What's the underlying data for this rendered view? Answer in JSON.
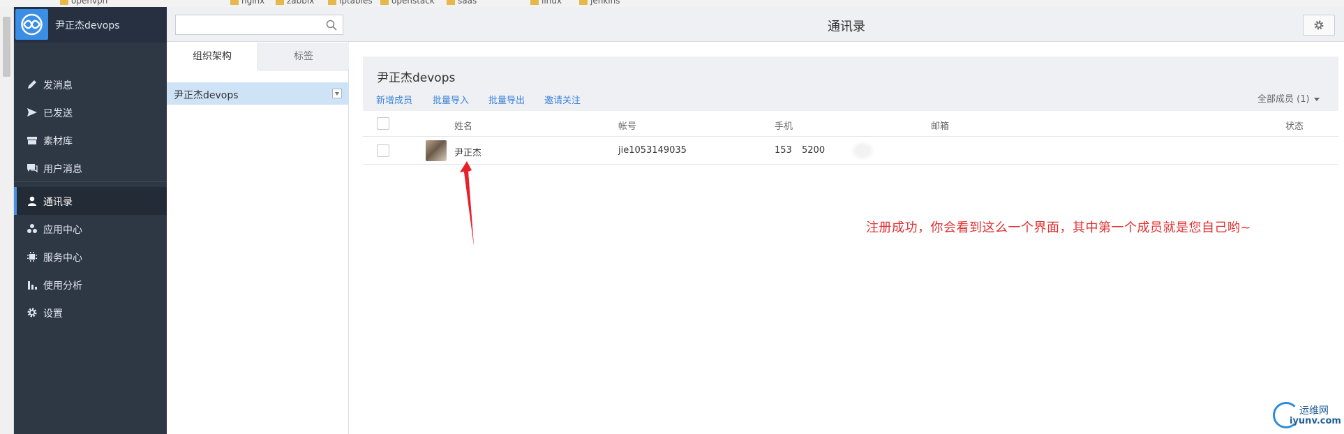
{
  "browser": {
    "bookmarks": [
      "openvpn",
      "nginx",
      "zabbix",
      "iptables",
      "openstack",
      "saas",
      "linux",
      "jenkins"
    ]
  },
  "sidebar": {
    "brand_name": "尹正杰devops",
    "items": [
      {
        "label": "发消息",
        "icon": "pencil-icon"
      },
      {
        "label": "已发送",
        "icon": "send-icon"
      },
      {
        "label": "素材库",
        "icon": "archive-icon"
      },
      {
        "label": "用户消息",
        "icon": "chat-icon"
      },
      {
        "label": "通讯录",
        "icon": "user-icon",
        "active": true
      },
      {
        "label": "应用中心",
        "icon": "apps-icon"
      },
      {
        "label": "服务中心",
        "icon": "service-icon"
      },
      {
        "label": "使用分析",
        "icon": "bar-chart-icon"
      },
      {
        "label": "设置",
        "icon": "gear-icon"
      }
    ]
  },
  "org_panel": {
    "search": {
      "placeholder": "",
      "value": ""
    },
    "tabs": [
      "组织架构",
      "标签"
    ],
    "active_tab": "组织架构",
    "tree_node": "尹正杰devops"
  },
  "main": {
    "title": "通讯录",
    "org_title": "尹正杰devops",
    "actions": [
      "新增成员",
      "批量导入",
      "批量导出",
      "邀请关注"
    ],
    "filter": "全部成员 (1)",
    "columns": [
      "姓名",
      "帐号",
      "手机",
      "邮箱",
      "状态"
    ],
    "rows": [
      {
        "name": "尹正杰",
        "account": "jie1053149035",
        "phone_prefix": "153",
        "phone_suffix": "5200",
        "email": "",
        "status": ""
      }
    ]
  },
  "annotation": {
    "text": "注册成功，你会看到这么一个界面，其中第一个成员就是您自己哟~",
    "color": "#e03030"
  },
  "watermark": {
    "cn": "运维网",
    "en": "iyunv.com"
  },
  "colors": {
    "sidebar_bg": "#2e3744",
    "accent": "#4a90e2",
    "link": "#3c82d8",
    "selected_node": "#cfe3f7"
  }
}
